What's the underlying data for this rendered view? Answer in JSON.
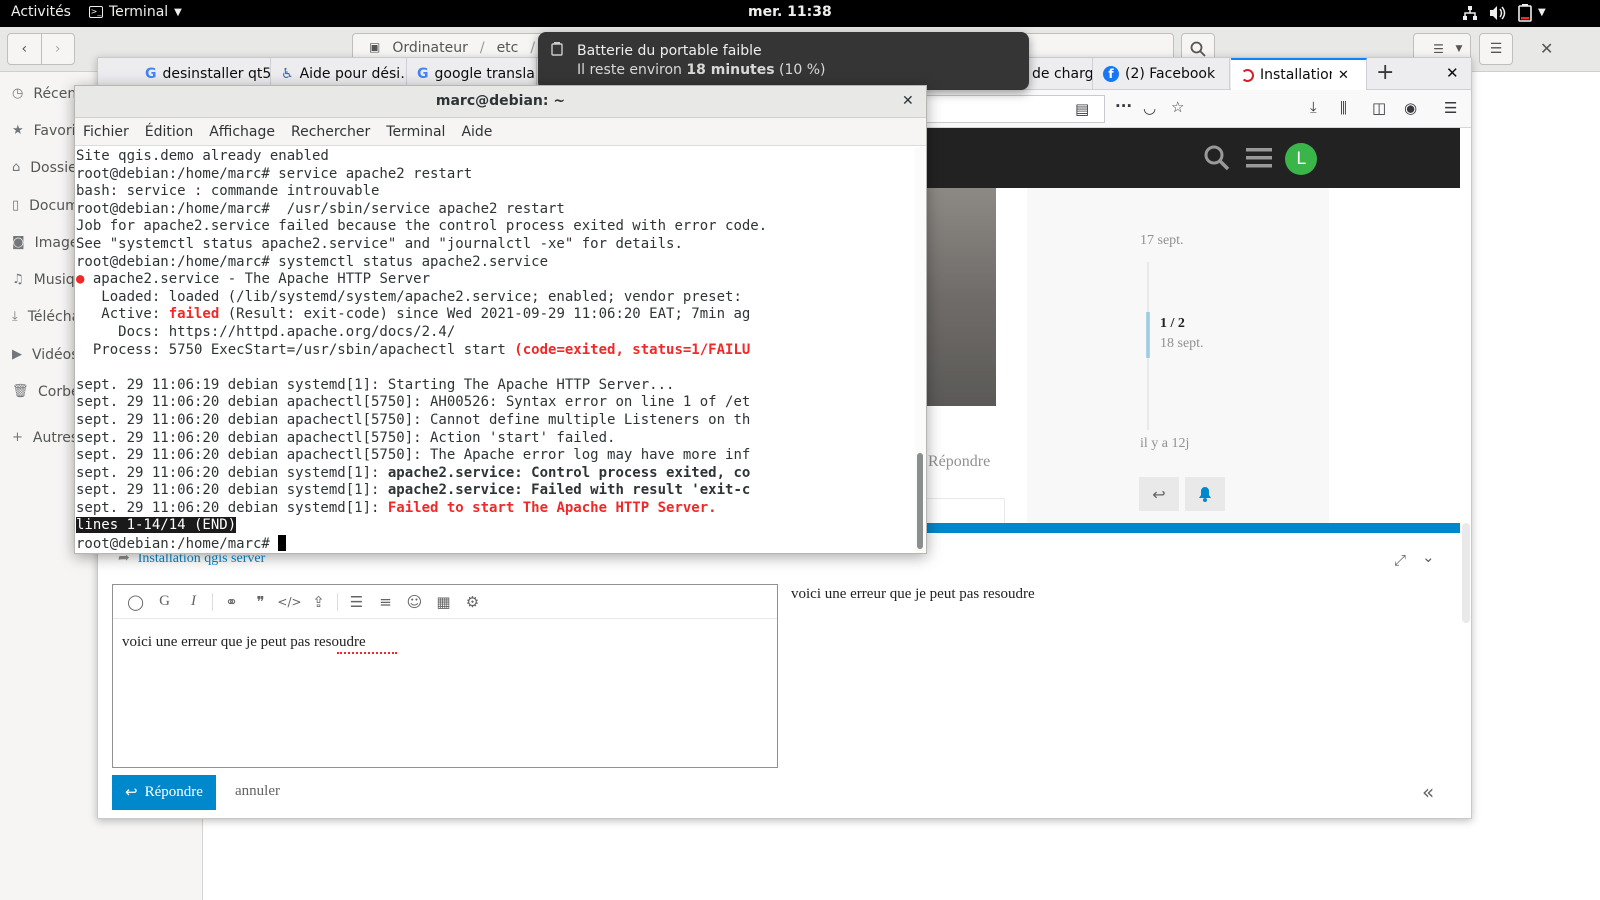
{
  "topbar": {
    "activities": "Activités",
    "app_name": "Terminal",
    "clock": "mer. 11:38"
  },
  "nautilus": {
    "path": [
      "Ordinateur",
      "etc"
    ],
    "sidebar": [
      {
        "label": "Récents",
        "icon": "clock-icon"
      },
      {
        "label": "Favoris",
        "icon": "star-icon"
      },
      {
        "label": "Dossier personnel",
        "icon": "home-icon"
      },
      {
        "label": "Documents",
        "icon": "document-icon"
      },
      {
        "label": "Images",
        "icon": "camera-icon"
      },
      {
        "label": "Musique",
        "icon": "music-icon"
      },
      {
        "label": "Téléchargements",
        "icon": "download-icon"
      },
      {
        "label": "Vidéos",
        "icon": "video-icon"
      },
      {
        "label": "Corbeille",
        "icon": "trash-icon"
      },
      {
        "label": "Autres emplacements",
        "icon": "plus-icon"
      }
    ]
  },
  "firefox": {
    "tabs": [
      {
        "label": "desinstaller qt5",
        "icon": "google-icon"
      },
      {
        "label": "Aide pour dési…",
        "icon": "help-icon"
      },
      {
        "label": "google transla…",
        "icon": "google-icon"
      },
      {
        "label": "de charg…",
        "icon": "page-icon"
      },
      {
        "label": "(2) Facebook",
        "icon": "facebook-icon"
      },
      {
        "label": "Installation",
        "icon": "discourse-icon",
        "active": true
      }
    ],
    "new_tab": "+",
    "close": "✕"
  },
  "forum": {
    "avatar_letter": "L",
    "timeline": {
      "start_date": "17 sept.",
      "position": "1 / 2",
      "position_date": "18 sept.",
      "end_label": "il y a 12j"
    },
    "reply_link": "Répondre",
    "composer": {
      "reply_to": "Installation qgis server",
      "editor_text": "voici une erreur que je peut pas resoudre",
      "preview_text": "voici une erreur que je peut pas resoudre",
      "submit_label": "Répondre",
      "cancel_label": "annuler"
    },
    "colors": {
      "accent": "#0088cc",
      "header": "#222222",
      "avatar": "#3ab54a"
    }
  },
  "notification": {
    "title": "Batterie du portable faible",
    "body_prefix": "Il reste environ ",
    "body_time": "18 minutes",
    "body_suffix": " (10 %)"
  },
  "terminal": {
    "title": "marc@debian: ~",
    "menu": [
      "Fichier",
      "Édition",
      "Affichage",
      "Rechercher",
      "Terminal",
      "Aide"
    ],
    "lines": [
      [
        {
          "t": "Site qgis.demo already enabled"
        }
      ],
      [
        {
          "t": "root@debian:/home/marc# service apache2 restart"
        }
      ],
      [
        {
          "t": "bash: service : commande introuvable"
        }
      ],
      [
        {
          "t": "root@debian:/home/marc#  /usr/sbin/service apache2 restart"
        }
      ],
      [
        {
          "t": "Job for apache2.service failed because the control process exited with error code."
        }
      ],
      [
        {
          "t": "See \"systemctl status apache2.service\" and \"journalctl -xe\" for details."
        }
      ],
      [
        {
          "t": "root@debian:/home/marc# systemctl status apache2.service"
        }
      ],
      [
        {
          "t": "●",
          "s": "red"
        },
        {
          "t": " apache2.service - The Apache HTTP Server"
        }
      ],
      [
        {
          "t": "   Loaded: loaded (/lib/systemd/system/apache2.service; enabled; vendor preset:"
        }
      ],
      [
        {
          "t": "   Active: "
        },
        {
          "t": "failed",
          "s": "red"
        },
        {
          "t": " (Result: exit-code) since Wed 2021-09-29 11:06:20 EAT; 7min ag"
        }
      ],
      [
        {
          "t": "     Docs: https://httpd.apache.org/docs/2.4/"
        }
      ],
      [
        {
          "t": "  Process: 5750 ExecStart=/usr/sbin/apachectl start "
        },
        {
          "t": "(code=exited, status=1/FAILU",
          "s": "red"
        }
      ],
      [
        {
          "t": ""
        }
      ],
      [
        {
          "t": "sept. 29 11:06:19 debian systemd[1]: Starting The Apache HTTP Server..."
        }
      ],
      [
        {
          "t": "sept. 29 11:06:20 debian apachectl[5750]: AH00526: Syntax error on line 1 of /et"
        }
      ],
      [
        {
          "t": "sept. 29 11:06:20 debian apachectl[5750]: Cannot define multiple Listeners on th"
        }
      ],
      [
        {
          "t": "sept. 29 11:06:20 debian apachectl[5750]: Action 'start' failed."
        }
      ],
      [
        {
          "t": "sept. 29 11:06:20 debian apachectl[5750]: The Apache error log may have more inf"
        }
      ],
      [
        {
          "t": "sept. 29 11:06:20 debian systemd[1]: "
        },
        {
          "t": "apache2.service: Control process exited, co",
          "s": "bold"
        }
      ],
      [
        {
          "t": "sept. 29 11:06:20 debian systemd[1]: "
        },
        {
          "t": "apache2.service: Failed with result 'exit-c",
          "s": "bold"
        }
      ],
      [
        {
          "t": "sept. 29 11:06:20 debian systemd[1]: "
        },
        {
          "t": "Failed to start The Apache HTTP Server.",
          "s": "red"
        }
      ],
      [
        {
          "t": "lines 1-14/14 (END)",
          "s": "inv"
        }
      ],
      [
        {
          "t": "root@debian:/home/marc# "
        },
        {
          "t": "",
          "s": "cursor"
        }
      ]
    ]
  }
}
